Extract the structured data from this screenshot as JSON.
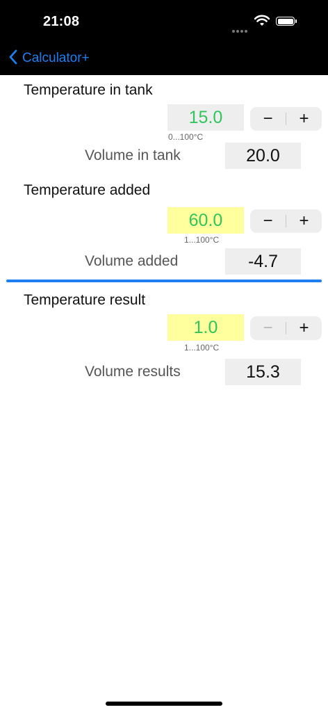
{
  "status_bar": {
    "time": "21:08",
    "signal_icon": "signal-dots-icon",
    "wifi_icon": "wifi-icon",
    "battery_icon": "battery-icon"
  },
  "nav": {
    "back_label": "Calculator+",
    "back_icon": "chevron-left-icon"
  },
  "accent_color": "#1e7ff0",
  "value_color": "#30c45a",
  "highlight_color": "#ffff9e",
  "sections": [
    {
      "title": "Temperature in tank",
      "value": "15.0",
      "range": "0...100°C",
      "minus": "−",
      "plus": "+",
      "volume_label": "Volume in tank",
      "volume_value": "20.0"
    },
    {
      "title": "Temperature added",
      "value": "60.0",
      "range": "1...100°C",
      "minus": "−",
      "plus": "+",
      "volume_label": "Volume added",
      "volume_value": "-4.7"
    },
    {
      "title": "Temperature result",
      "value": "1.0",
      "range": "1...100°C",
      "minus": "−",
      "plus": "+",
      "minus_disabled": true,
      "volume_label": "Volume results",
      "volume_value": "15.3"
    }
  ]
}
